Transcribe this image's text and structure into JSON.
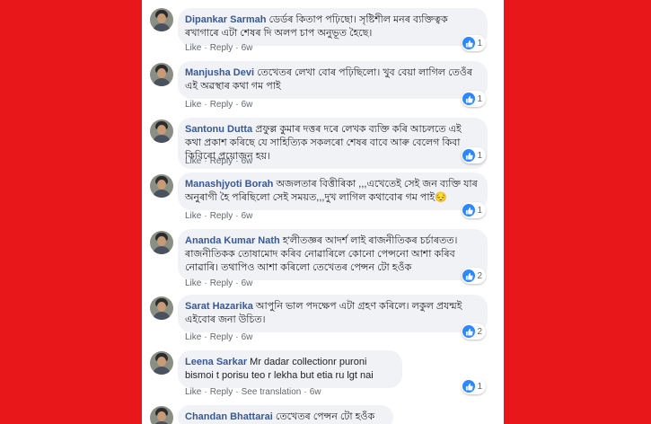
{
  "comments": [
    {
      "name": "Dipankar Sarmah",
      "text": "ডেৰ্ডৰ কিতাপ পঢ়িছো। সৃষ্টিশীল মনৰ ব্যক্তিত্বক ৰখাগাৰে এটা শেষৰ দি অলপ চাপ অনুভূত হৈছে।",
      "like": "Like",
      "reply": "Reply",
      "time": "6w",
      "reactions": "1"
    },
    {
      "name": "Manjusha Devi",
      "text": "তেখেতৰ লেখা বোৰ পঢ়িছিলো। খুব বেয়া লাগিল তেওঁৰ এই অৱস্থাৰ কথা গম পাই",
      "like": "Like",
      "reply": "Reply",
      "time": "6w",
      "reactions": "1"
    },
    {
      "name": "Santonu Dutta",
      "text": "প্ৰফুল্ল কুমাৰ দত্তৰ দৰে লেখক ব্যক্তি কৰি আচলতে এই কথা প্ৰকাশ কৰিছে যে সাহিত্যিক সকলৰো শেষৰ বাবে আৰু বেলেগ কিবা কিবিৰো প্ৰয়োজন হয়।",
      "like": "Like",
      "reply": "Reply",
      "time": "6w",
      "reactions": "1"
    },
    {
      "name": "Manashjyoti Borah",
      "text": "অজলতাৰ বিত্তীৰিকা ,,,এখেতেই সেই জন ব্যক্তি যাৰ অনুৰাগী হৈ পৰিছিলো সেই সময়ত,,,দুখ লাগিল কথাবোৰ গম পাই😔",
      "like": "Like",
      "reply": "Reply",
      "time": "6w",
      "reactions": "1"
    },
    {
      "name": "Ananda Kumar Nath",
      "text": "হ'লীতজ্ঞৰ আদৰ্শ লাই ৰাজনীতিকৰ চৰ্চাৰতত। ৰাজনীতিকক তোষামোদ কৰিব নোৱাৰিলে কোনো পেন্সনো আশা কৰিব নোৱাৰি। তথাপিও আশা কৰিলো তেখেতৰ পেন্সন টো হওঁক",
      "like": "Like",
      "reply": "Reply",
      "time": "6w",
      "reactions": "2"
    },
    {
      "name": "Sarat Hazarika",
      "text": "আপুনি ভাল পদক্ষেপ এটা গ্ৰহণ কৰিলে। লকুল প্ৰযন্মই এইবোৰ জনা উচিত।",
      "like": "Like",
      "reply": "Reply",
      "time": "6w",
      "reactions": "2"
    },
    {
      "name": "Leena Sarkar",
      "text": "Mr dadar collectionr puroni bismoi t porisu teo r lekha but etia ru lgt nai",
      "like": "Like",
      "reply": "Reply",
      "see_translation": "See translation",
      "time": "6w",
      "reactions": "1"
    },
    {
      "name": "Chandan Bhattarai",
      "text": "তেখেতৰ পেন্সন টো হওঁক"
    }
  ],
  "colors": {
    "background": "#e8171a",
    "name": "#385898",
    "bubble": "#f0f2f5",
    "like": "#2d88ff"
  },
  "icons": {
    "reaction": "thumbs-up-icon"
  }
}
